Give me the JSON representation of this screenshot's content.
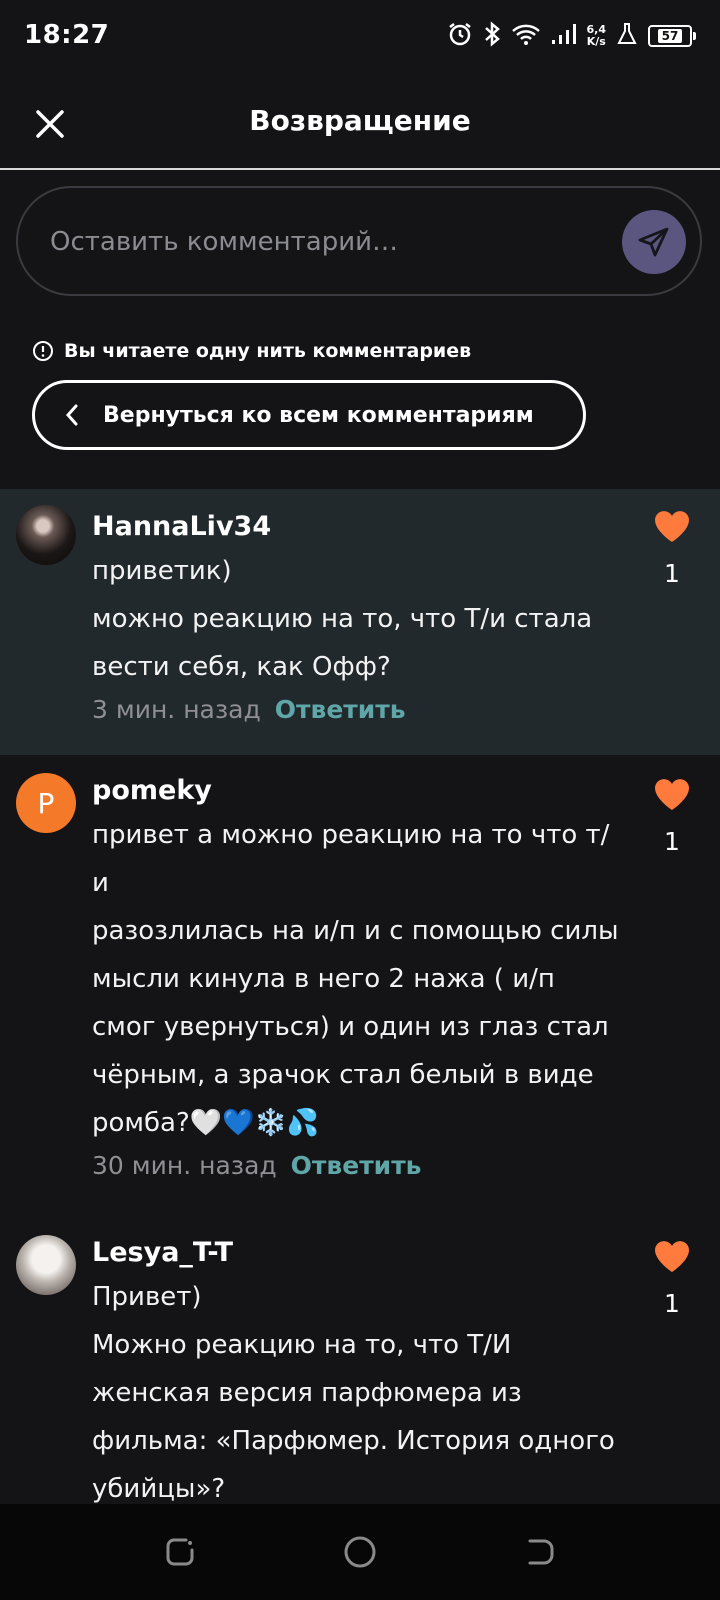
{
  "status": {
    "time": "18:27",
    "speed_value": "6,4",
    "speed_unit": "K/s",
    "battery": "57",
    "icons": [
      "alarm-icon",
      "bluetooth-icon",
      "wifi-icon",
      "signal-icon",
      "flask-icon",
      "battery-icon"
    ]
  },
  "header": {
    "title": "Возвращение",
    "close_icon": "close-icon"
  },
  "comment_box": {
    "placeholder": "Оставить комментарий…",
    "send_icon": "send-icon",
    "accent": "#5a5680"
  },
  "thread": {
    "notice": "Вы читаете одну нить комментариев",
    "back_label": "Вернуться ко всем комментариям"
  },
  "comments": [
    {
      "author": "HannaLiv34",
      "text": "приветик)\nможно реакцию на то, что Т/и стала вести себя, как Офф?",
      "time": "3 мин. назад",
      "reply": "Ответить",
      "likes": "1",
      "highlighted": true
    },
    {
      "author": "pomeky",
      "avatar_letter": "P",
      "text": "привет а можно реакцию на то что т/\nи\nразозлилась на и/п и с помощью силы мысли кинула в него 2 нажа ( и/п смог увернуться) и один из глаз стал чёрным, а зрачок стал белый в виде ромба?🤍💙❄️💦",
      "time": "30 мин. назад",
      "reply": "Ответить",
      "likes": "1"
    },
    {
      "author": "Lesya_T-T",
      "text": "Привет)\nМожно реакцию на то, что Т/И женская версия парфюмера из фильма: «Парфюмер. История одного убийцы»?",
      "likes": "1"
    }
  ],
  "colors": {
    "background": "#141416",
    "highlight": "#22292c",
    "heart": "#ff7a3d",
    "reply": "#5fa6a8",
    "avatar_orange": "#f47a2a"
  },
  "nav": [
    "recents-icon",
    "home-icon",
    "back-icon"
  ]
}
